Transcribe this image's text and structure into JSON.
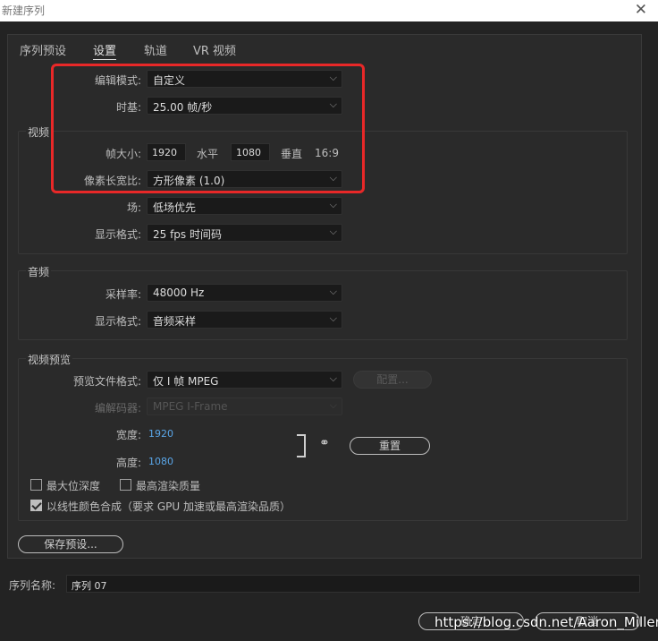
{
  "window": {
    "title": "新建序列",
    "close_glyph": "✕"
  },
  "tabs": [
    "序列预设",
    "设置",
    "轨道",
    "VR 视频"
  ],
  "editing": {
    "mode_label": "编辑模式:",
    "mode_value": "自定义",
    "timebase_label": "时基:",
    "timebase_value": "25.00  帧/秒"
  },
  "video": {
    "section_title": "视频",
    "frame_size_label": "帧大小:",
    "width_value": "1920",
    "horizontal_label": "水平",
    "height_value": "1080",
    "vertical_label": "垂直",
    "ratio": "16:9",
    "pixel_aspect_label": "像素长宽比:",
    "pixel_aspect_value": "方形像素 (1.0)",
    "field_label": "场:",
    "field_value": "低场优先",
    "display_format_label": "显示格式:",
    "display_format_value": "25 fps 时间码"
  },
  "audio": {
    "section_title": "音频",
    "sample_rate_label": "采样率:",
    "sample_rate_value": "48000 Hz",
    "display_format_label": "显示格式:",
    "display_format_value": "音频采样"
  },
  "preview": {
    "section_title": "视频预览",
    "file_format_label": "预览文件格式:",
    "file_format_value": "仅 I 帧 MPEG",
    "configure_label": "配置...",
    "codec_label": "编解码器:",
    "codec_value": "MPEG I-Frame",
    "width_label": "宽度:",
    "width_value": "1920",
    "height_label": "高度:",
    "height_value": "1080",
    "reset_label": "重置",
    "max_bit_depth_label": "最大位深度",
    "max_render_quality_label": "最高渲染质量",
    "linear_color_label": "以线性颜色合成（要求 GPU 加速或最高渲染品质）"
  },
  "save_preset_label": "保存预设...",
  "sequence_name": {
    "label": "序列名称:",
    "value": "序列 07"
  },
  "buttons": {
    "ok": "确定",
    "cancel": "取消"
  },
  "watermark": "https://blog.csdn.net/Aaron_Miller",
  "highlight_color": "#e82828"
}
